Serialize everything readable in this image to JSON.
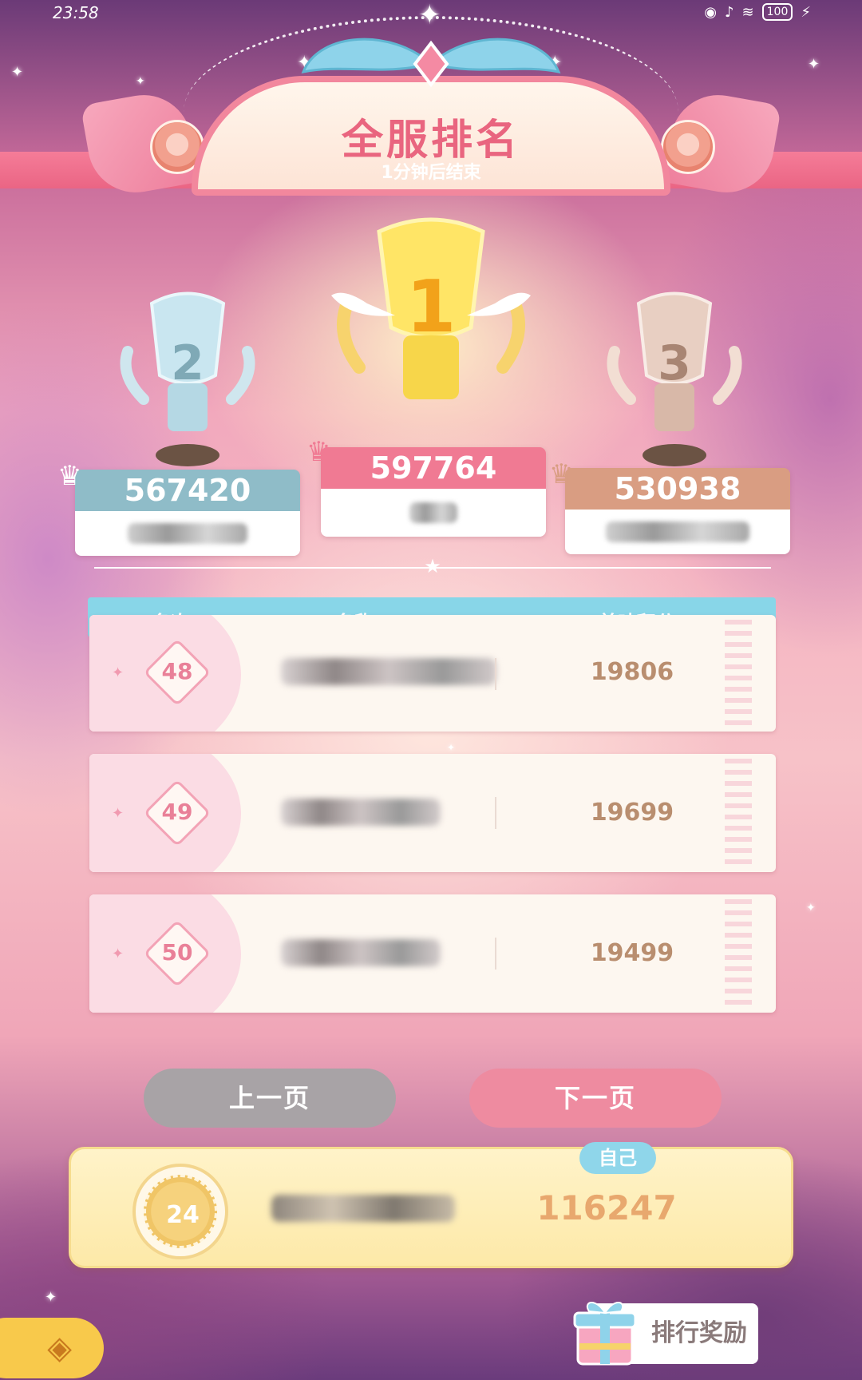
{
  "status_bar": {
    "time": "23:58",
    "battery": "100"
  },
  "header": {
    "title": "全服排名",
    "subtitle": "1分钟后结束"
  },
  "podium": [
    {
      "rank": "2",
      "score": "567420",
      "color": "#8fbcc8"
    },
    {
      "rank": "1",
      "score": "597764",
      "color": "#f07a93"
    },
    {
      "rank": "3",
      "score": "530938",
      "color": "#d99d82"
    }
  ],
  "table": {
    "headers": {
      "rank": "名次",
      "name": "名称",
      "score": "美味积分"
    },
    "rows": [
      {
        "rank": "48",
        "score": "19806"
      },
      {
        "rank": "49",
        "score": "19699"
      },
      {
        "rank": "50",
        "score": "19499"
      }
    ]
  },
  "pagination": {
    "prev": "上一页",
    "next": "下一页"
  },
  "self": {
    "tag": "自己",
    "rank": "24",
    "score": "116247"
  },
  "reward_button": {
    "label": "排行奖励"
  }
}
